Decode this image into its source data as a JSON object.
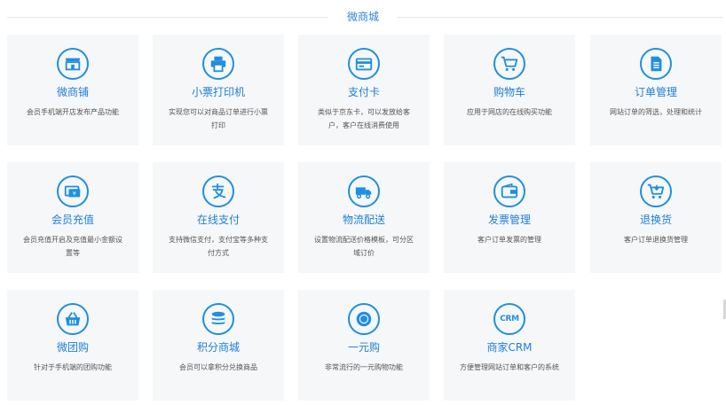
{
  "section": {
    "title": "微商城"
  },
  "cards": [
    {
      "name": "微商铺",
      "desc": "会员手机端开店发布产品功能",
      "icon": "store-icon"
    },
    {
      "name": "小票打印机",
      "desc": "实现您可以对商品订单进行小票打印",
      "icon": "printer-icon"
    },
    {
      "name": "支付卡",
      "desc": "类似于京东卡，可以发放给客户，客户在线消费使用",
      "icon": "payment-card-icon"
    },
    {
      "name": "购物车",
      "desc": "应用于网店的在线购买功能",
      "icon": "shopping-cart-icon"
    },
    {
      "name": "订单管理",
      "desc": "网站订单的筛选，处理和统计",
      "icon": "order-document-icon"
    },
    {
      "name": "会员充值",
      "desc": "会员充值开启及充值最小金额设置等",
      "icon": "recharge-icon"
    },
    {
      "name": "在线支付",
      "desc": "支持微信支付，支付宝等多种支付方式",
      "icon": "alipay-icon"
    },
    {
      "name": "物流配送",
      "desc": "设置物流配送价格模板，可分区域订价",
      "icon": "delivery-truck-icon"
    },
    {
      "name": "发票管理",
      "desc": "客户订单发票的管理",
      "icon": "wallet-icon"
    },
    {
      "name": "退换货",
      "desc": "客户订单退换货管理",
      "icon": "return-cart-icon"
    },
    {
      "name": "微团购",
      "desc": "针对于手机端的团购功能",
      "icon": "basket-icon"
    },
    {
      "name": "积分商城",
      "desc": "会员可以拿积分兑换商品",
      "icon": "coin-stack-icon"
    },
    {
      "name": "一元购",
      "desc": "非常流行的一元购物功能",
      "icon": "circle-dot-icon"
    },
    {
      "name": "商家CRM",
      "desc": "方便管理网站订单和客户的系统",
      "icon": "crm-icon",
      "icon_text": "CRM"
    }
  ],
  "colors": {
    "accent": "#1f8fe1",
    "card_bg": "#f6f7f8",
    "title": "#2c86d8",
    "desc": "#555555"
  }
}
